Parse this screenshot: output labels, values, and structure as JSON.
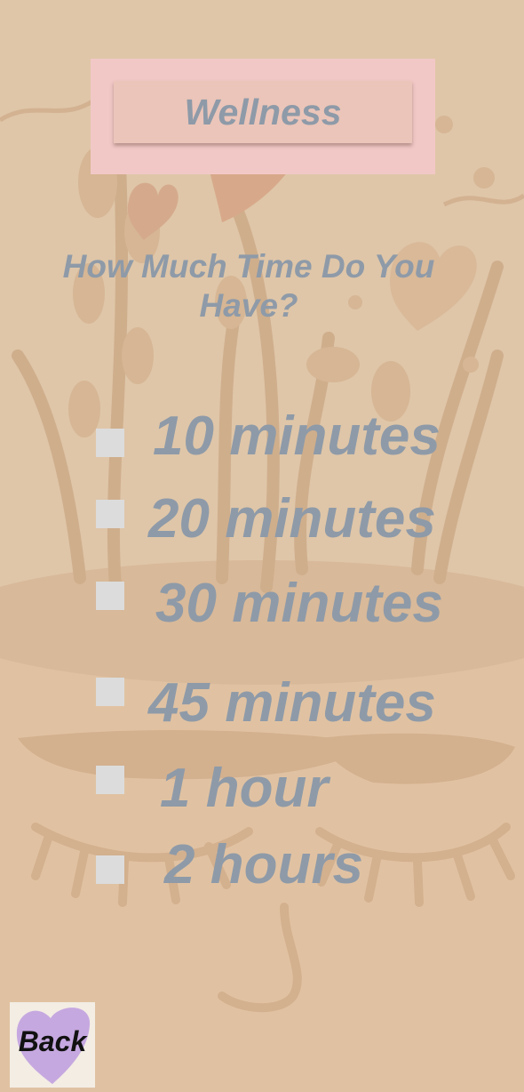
{
  "header": {
    "title": "Wellness"
  },
  "question": "How Much Time Do You Have?",
  "options": [
    {
      "label": "10 minutes"
    },
    {
      "label": "20 minutes"
    },
    {
      "label": "30 minutes"
    },
    {
      "label": "45 minutes"
    },
    {
      "label": "1 hour"
    },
    {
      "label": "2 hours"
    }
  ],
  "back": {
    "label": "Back",
    "icon": "heart-icon"
  },
  "colors": {
    "background": "#e0c2a2",
    "header_frame": "#f2c8c6",
    "header_button": "#ebc5b9",
    "text": "#8e9aa8",
    "checkbox": "#dcdcdc",
    "back_heart": "#c6a8e0"
  }
}
